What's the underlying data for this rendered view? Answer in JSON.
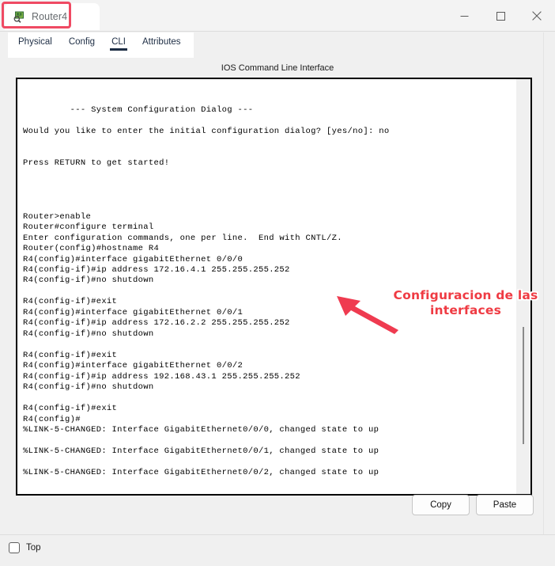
{
  "window": {
    "title": "Router4",
    "icon": "router-device-icon",
    "controls": {
      "minimize": "minimize-icon",
      "maximize": "maximize-icon",
      "close": "close-icon"
    },
    "highlight_color": "#ef4a63"
  },
  "tabs": {
    "items": [
      {
        "label": "Physical",
        "active": false
      },
      {
        "label": "Config",
        "active": false
      },
      {
        "label": "CLI",
        "active": true
      },
      {
        "label": "Attributes",
        "active": false
      }
    ],
    "active_color": "#1d2d44"
  },
  "panel": {
    "header": "IOS Command Line Interface"
  },
  "terminal": {
    "lines": [
      "",
      "",
      "         --- System Configuration Dialog ---",
      "",
      "Would you like to enter the initial configuration dialog? [yes/no]: no",
      "",
      "",
      "Press RETURN to get started!",
      "",
      "",
      "",
      "",
      "Router>enable",
      "Router#configure terminal",
      "Enter configuration commands, one per line.  End with CNTL/Z.",
      "Router(config)#hostname R4",
      "R4(config)#interface gigabitEthernet 0/0/0",
      "R4(config-if)#ip address 172.16.4.1 255.255.255.252",
      "R4(config-if)#no shutdown",
      "",
      "R4(config-if)#exit",
      "R4(config)#interface gigabitEthernet 0/0/1",
      "R4(config-if)#ip address 172.16.2.2 255.255.255.252",
      "R4(config-if)#no shutdown",
      "",
      "R4(config-if)#exit",
      "R4(config)#interface gigabitEthernet 0/0/2",
      "R4(config-if)#ip address 192.168.43.1 255.255.255.252",
      "R4(config-if)#no shutdown",
      "",
      "R4(config-if)#exit",
      "R4(config)#",
      "%LINK-5-CHANGED: Interface GigabitEthernet0/0/0, changed state to up",
      "",
      "%LINK-5-CHANGED: Interface GigabitEthernet0/0/1, changed state to up",
      "",
      "%LINK-5-CHANGED: Interface GigabitEthernet0/0/2, changed state to up"
    ]
  },
  "annotation": {
    "text": "Configuracion de las interfaces",
    "color": "#ef3b43",
    "outline_color": "#ffffff",
    "arrow": "left-arrow-icon"
  },
  "actions": {
    "copy_label": "Copy",
    "paste_label": "Paste"
  },
  "footer": {
    "top_checkbox_label": "Top",
    "top_checkbox_checked": false
  }
}
